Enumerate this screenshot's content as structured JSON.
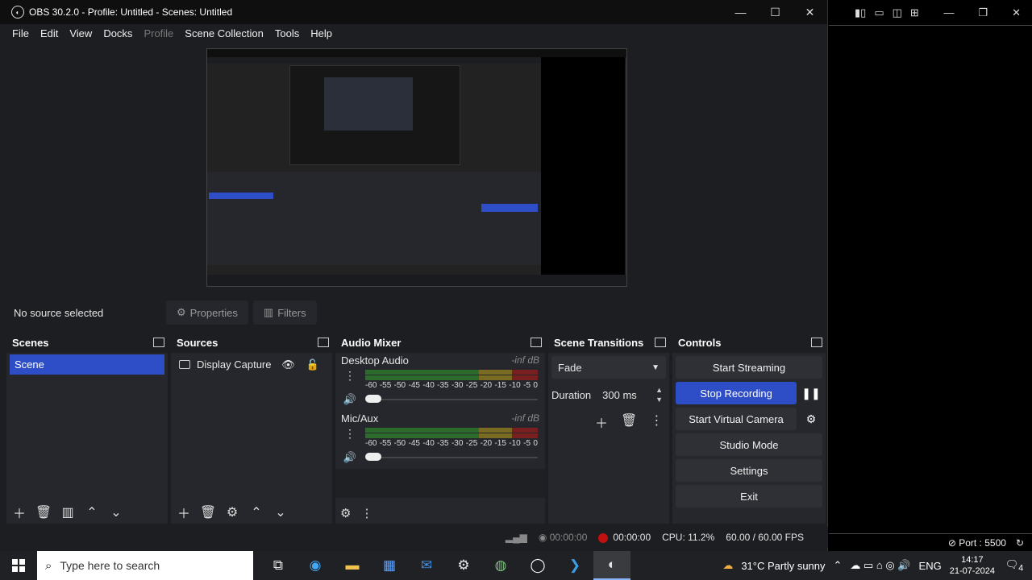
{
  "window": {
    "title": "OBS 30.2.0 - Profile: Untitled - Scenes: Untitled",
    "minimize": "—",
    "maximize": "☐",
    "close": "✕"
  },
  "menu": [
    "File",
    "Edit",
    "View",
    "Docks",
    "Profile",
    "Scene Collection",
    "Tools",
    "Help"
  ],
  "source_bar": {
    "no_source": "No source selected",
    "properties": "Properties",
    "filters": "Filters"
  },
  "scenes": {
    "title": "Scenes",
    "items": [
      "Scene"
    ]
  },
  "sources": {
    "title": "Sources",
    "items": [
      "Display Capture"
    ]
  },
  "mixer": {
    "title": "Audio Mixer",
    "channels": [
      {
        "name": "Desktop Audio",
        "db": "-inf dB",
        "volume": 0
      },
      {
        "name": "Mic/Aux",
        "db": "-inf dB",
        "volume": 0
      }
    ],
    "scale": [
      "-60",
      "-55",
      "-50",
      "-45",
      "-40",
      "-35",
      "-30",
      "-25",
      "-20",
      "-15",
      "-10",
      "-5",
      "0"
    ]
  },
  "transitions": {
    "title": "Scene Transitions",
    "selected": "Fade",
    "duration_label": "Duration",
    "duration_value": "300 ms"
  },
  "controls": {
    "title": "Controls",
    "start_streaming": "Start Streaming",
    "stop_recording": "Stop Recording",
    "start_virtual_camera": "Start Virtual Camera",
    "studio_mode": "Studio Mode",
    "settings": "Settings",
    "exit": "Exit"
  },
  "status": {
    "stream_time": "00:00:00",
    "rec_time": "00:00:00",
    "cpu": "CPU: 11.2%",
    "fps": "60.00 / 60.00 FPS"
  },
  "right_window": {
    "port": "Port : 5500"
  },
  "taskbar": {
    "search_placeholder": "Type here to search",
    "weather": "31°C  Partly sunny",
    "lang": "ENG",
    "time": "14:17",
    "date": "21-07-2024",
    "notif_count": "4"
  },
  "colors": {
    "accent": "#2d4ec7",
    "panel": "#26272c",
    "background": "#1d1e22",
    "recording": "#c01010"
  }
}
